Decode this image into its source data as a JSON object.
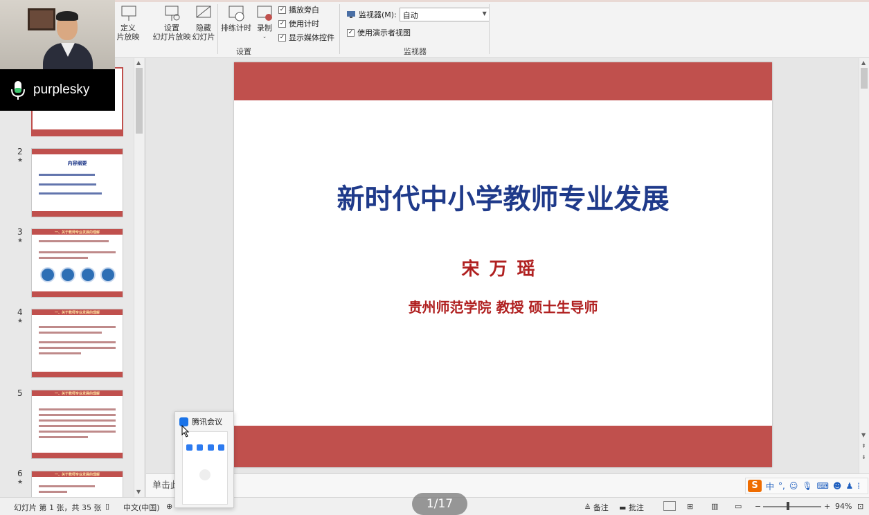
{
  "ribbon": {
    "custom_show": {
      "line1": "定义",
      "line2": "片放映"
    },
    "setup_show": {
      "line1": "设置",
      "line2": "幻灯片放映"
    },
    "hide_slide": {
      "line1": "隐藏",
      "line2": "幻灯片"
    },
    "rehearse": "排练计时",
    "record": "录制",
    "checkboxes": [
      {
        "label": "播放旁白",
        "checked": true
      },
      {
        "label": "使用计时",
        "checked": true
      },
      {
        "label": "显示媒体控件",
        "checked": true
      }
    ],
    "group_setup": "设置",
    "monitor_label": "监视器(M):",
    "monitor_value": "自动",
    "presenter_view": "使用演示者视图",
    "group_monitor": "监视器"
  },
  "webcam": {
    "speaker_name": "purplesky"
  },
  "thumbnails": [
    {
      "num": "2",
      "title": "内容纲要"
    },
    {
      "num": "3",
      "title": "一、关于教师专业发展的理解"
    },
    {
      "num": "4",
      "title": "一、关于教师专业发展的理解"
    },
    {
      "num": "5",
      "title": "一、关于教师专业发展的理解"
    },
    {
      "num": "6",
      "title": "一、关于教师专业发展的理解"
    }
  ],
  "slide": {
    "title": "新时代中小学教师专业发展",
    "author": "宋万瑶",
    "affiliation": "贵州师范学院 教授 硕士生导师"
  },
  "notes_hint": "单击此",
  "popup": {
    "app_name": "腾讯会议"
  },
  "pager": "1/17",
  "status": {
    "slide_info": "幻灯片 第 1 张，共 35 张",
    "language": "中文(中国)",
    "notes": "备注",
    "comments": "批注",
    "zoom": "94%"
  },
  "ime": {
    "logo": "S",
    "mode": "中"
  },
  "colors": {
    "accent_red": "#c0504d",
    "title_blue": "#1f3a8a",
    "text_red": "#b02020"
  }
}
